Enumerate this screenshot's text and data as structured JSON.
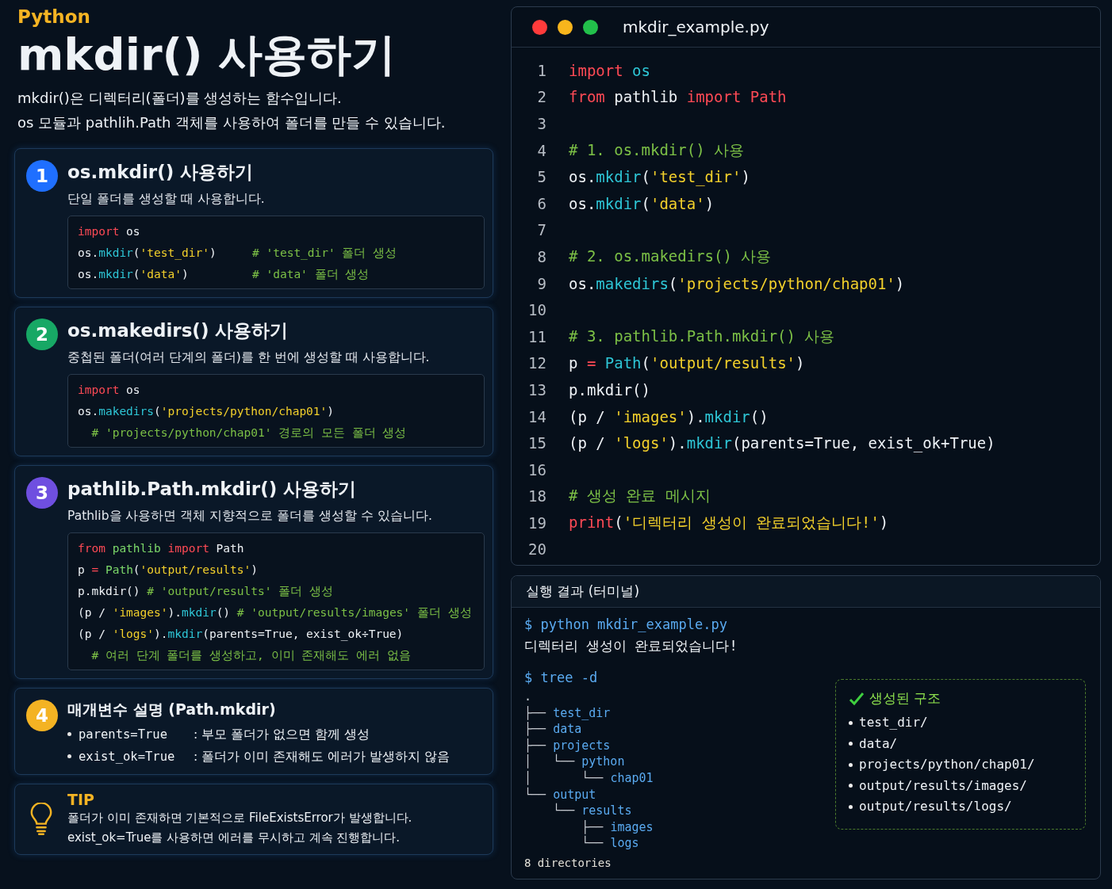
{
  "header": {
    "eyebrow": "Python",
    "title": "mkdir() 사용하기",
    "description": [
      "mkdir()은 디렉터리(폴더)를 생성하는 함수입니다.",
      "os 모듈과 pathlih.Path 객체를 사용하여 폴더를 만들 수 있습니다."
    ]
  },
  "cards": [
    {
      "kind": "code",
      "number": "1",
      "color": "#1f6fff",
      "title": "os.mkdir() 사용하기",
      "description": "단일 폴더를 생성할 때 사용합니다.",
      "code": [
        {
          "tokens": [
            {
              "t": "import",
              "kind": "kw"
            },
            {
              "t": " os",
              "kind": "tx"
            }
          ]
        },
        {
          "tokens": [
            {
              "t": "os.",
              "kind": "tx"
            },
            {
              "t": "mkdir",
              "kind": "fn"
            },
            {
              "t": "(",
              "kind": "tx"
            },
            {
              "t": "'test_dir'",
              "kind": "str"
            },
            {
              "t": ")",
              "kind": "tx"
            }
          ],
          "comment": "# 'test_dir' 폴더 생성"
        },
        {
          "tokens": [
            {
              "t": "os.",
              "kind": "tx"
            },
            {
              "t": "mkdir",
              "kind": "fn"
            },
            {
              "t": "(",
              "kind": "tx"
            },
            {
              "t": "'data'",
              "kind": "str"
            },
            {
              "t": ")",
              "kind": "tx"
            }
          ],
          "comment": "# 'data' 폴더 생성"
        }
      ]
    },
    {
      "kind": "code",
      "number": "2",
      "color": "#17a865",
      "title": "os.makedirs() 사용하기",
      "description": "중첩된 폴더(여러 단계의 폴더)를 한 번에 생성할 때 사용합니다.",
      "code": [
        {
          "tokens": [
            {
              "t": "import",
              "kind": "kw"
            },
            {
              "t": " os",
              "kind": "tx"
            }
          ]
        },
        {
          "tokens": [
            {
              "t": "os.",
              "kind": "tx"
            },
            {
              "t": "makedirs",
              "kind": "fn"
            },
            {
              "t": "(",
              "kind": "tx"
            },
            {
              "t": "'projects/python/chap01'",
              "kind": "str"
            },
            {
              "t": ")",
              "kind": "tx"
            }
          ]
        },
        {
          "tokens": [
            {
              "t": "  # 'projects/python/chap01' 경로의 모든 폴더 생성",
              "kind": "cm"
            }
          ]
        }
      ]
    },
    {
      "kind": "code",
      "number": "3",
      "color": "#6f4fe0",
      "title": "pathlib.Path.mkdir() 사용하기",
      "description": "Pathlib을 사용하면 객체 지향적으로 폴더를 생성할 수 있습니다.",
      "code": [
        {
          "tokens": [
            {
              "t": "from ",
              "kind": "kw"
            },
            {
              "t": "pathlib ",
              "kind": "mod"
            },
            {
              "t": "import",
              "kind": "kw"
            },
            {
              "t": " Path",
              "kind": "tx"
            }
          ]
        },
        {
          "tokens": [
            {
              "t": "p ",
              "kind": "tx"
            },
            {
              "t": "= ",
              "kind": "kw"
            },
            {
              "t": "Path",
              "kind": "mod"
            },
            {
              "t": "(",
              "kind": "tx"
            },
            {
              "t": "'output/results'",
              "kind": "str"
            },
            {
              "t": ")",
              "kind": "tx"
            }
          ]
        },
        {
          "tokens": [
            {
              "t": "p.mkdir() ",
              "kind": "tx"
            },
            {
              "t": "# 'output/results' 폴더 생성",
              "kind": "cm"
            }
          ]
        },
        {
          "tokens": [
            {
              "t": "(p / ",
              "kind": "tx"
            },
            {
              "t": "'images'",
              "kind": "str"
            },
            {
              "t": ").",
              "kind": "tx"
            },
            {
              "t": "mkdir",
              "kind": "fn"
            },
            {
              "t": "() ",
              "kind": "tx"
            },
            {
              "t": "# 'output/results/images' 폴더 생성",
              "kind": "cm"
            }
          ]
        },
        {
          "tokens": [
            {
              "t": "(p / ",
              "kind": "tx"
            },
            {
              "t": "'logs'",
              "kind": "str"
            },
            {
              "t": ").",
              "kind": "tx"
            },
            {
              "t": "mkdir",
              "kind": "fn"
            },
            {
              "t": "(parents=True, exist_ok÷True)",
              "kind": "tx"
            }
          ]
        },
        {
          "tokens": [
            {
              "t": "  # 여러 단계 폴더를 생성하고, 이미 존재해도 에러 없음",
              "kind": "cm"
            }
          ]
        }
      ]
    },
    {
      "kind": "params",
      "number": "4",
      "color": "#f4b323",
      "title": "매개변수 설명 (Path.mkdir)",
      "params": [
        {
          "name": "parents=True",
          "text": ": 부모 폴더가 없으면 함께 생성"
        },
        {
          "name": "exist_ok=True",
          "text": ": 폴더가 이미 존재해도 에러가 발생하지 않음"
        }
      ]
    },
    {
      "kind": "tip",
      "title": "TIP",
      "lines": [
        "폴더가 이미 존재하면 기본적으로 FileExistsError가 발생합니다.",
        "exist_ok=True를 사용하면 에러를 무시하고 계속 진행합니다."
      ]
    }
  ],
  "editor": {
    "filename": "mkdir_example.py",
    "lines": [
      {
        "n": "1",
        "tokens": [
          {
            "t": "import ",
            "kind": "kw"
          },
          {
            "t": "os",
            "kind": "fn"
          }
        ]
      },
      {
        "n": "2",
        "tokens": [
          {
            "t": "from",
            "kind": "kw"
          },
          {
            "t": " pathlib ",
            "kind": "tx"
          },
          {
            "t": "import Path",
            "kind": "kw"
          }
        ]
      },
      {
        "n": "3"
      },
      {
        "n": "4",
        "tokens": [
          {
            "t": "# 1. os.mkdir() 사용",
            "kind": "cm"
          }
        ]
      },
      {
        "n": "5",
        "tokens": [
          {
            "t": "os.",
            "kind": "tx"
          },
          {
            "t": "mkdir",
            "kind": "fn"
          },
          {
            "t": "(",
            "kind": "tx"
          },
          {
            "t": "'test_dir'",
            "kind": "str"
          },
          {
            "t": ")",
            "kind": "tx"
          }
        ]
      },
      {
        "n": "6",
        "tokens": [
          {
            "t": "os.",
            "kind": "tx"
          },
          {
            "t": "mkdir",
            "kind": "fn"
          },
          {
            "t": "(",
            "kind": "tx"
          },
          {
            "t": "'data'",
            "kind": "str"
          },
          {
            "t": ")",
            "kind": "tx"
          }
        ]
      },
      {
        "n": "7"
      },
      {
        "n": "8",
        "tokens": [
          {
            "t": "# 2. os.makedirs() 사용",
            "kind": "cm"
          }
        ]
      },
      {
        "n": "9",
        "tokens": [
          {
            "t": "os.",
            "kind": "tx"
          },
          {
            "t": "makedirs",
            "kind": "fn"
          },
          {
            "t": "(",
            "kind": "tx"
          },
          {
            "t": "'projects/python/chap01'",
            "kind": "str"
          },
          {
            "t": ")",
            "kind": "tx"
          }
        ]
      },
      {
        "n": "10"
      },
      {
        "n": "11",
        "tokens": [
          {
            "t": "# 3. pathlib.Path.mkdir() 사용",
            "kind": "cm"
          }
        ]
      },
      {
        "n": "12",
        "tokens": [
          {
            "t": "p ",
            "kind": "tx"
          },
          {
            "t": "= ",
            "kind": "kw"
          },
          {
            "t": "Path",
            "kind": "fn"
          },
          {
            "t": "(",
            "kind": "tx"
          },
          {
            "t": "'output/results'",
            "kind": "str"
          },
          {
            "t": ")",
            "kind": "tx"
          }
        ]
      },
      {
        "n": "13",
        "tokens": [
          {
            "t": "p.mkdir()",
            "kind": "tx"
          }
        ]
      },
      {
        "n": "14",
        "tokens": [
          {
            "t": "(p / ",
            "kind": "tx"
          },
          {
            "t": "'images'",
            "kind": "str"
          },
          {
            "t": ").",
            "kind": "tx"
          },
          {
            "t": "mkdir",
            "kind": "fn"
          },
          {
            "t": "()",
            "kind": "tx"
          }
        ]
      },
      {
        "n": "15",
        "tokens": [
          {
            "t": "(p / ",
            "kind": "tx"
          },
          {
            "t": "'logs'",
            "kind": "str"
          },
          {
            "t": ").",
            "kind": "tx"
          },
          {
            "t": "mkdir",
            "kind": "fn"
          },
          {
            "t": "(parents=True, exist_ok+True)",
            "kind": "tx"
          }
        ]
      },
      {
        "n": "16"
      },
      {
        "n": "18",
        "tokens": [
          {
            "t": "# 생성 완료 메시지",
            "kind": "cm"
          }
        ]
      },
      {
        "n": "19",
        "tokens": [
          {
            "t": "print",
            "kind": "kw"
          },
          {
            "t": "(",
            "kind": "tx"
          },
          {
            "t": "'디렉터리 생성이 완료되었습니다!'",
            "kind": "str"
          },
          {
            "t": ")",
            "kind": "tx"
          }
        ]
      },
      {
        "n": "20"
      }
    ]
  },
  "terminal": {
    "title": "실행 결과 (터미널)",
    "lines": [
      {
        "kind": "cmd",
        "text": "$ python mkdir_example.py"
      },
      {
        "kind": "out",
        "text": "디렉터리 생성이 완료되었습니다!"
      },
      {
        "kind": "gap"
      },
      {
        "kind": "cmd",
        "text": "$ tree -d"
      },
      {
        "kind": "tree",
        "prefix": "."
      },
      {
        "kind": "tree",
        "prefix": "├── ",
        "name": "test_dir"
      },
      {
        "kind": "tree",
        "prefix": "├── ",
        "name": "data"
      },
      {
        "kind": "tree",
        "prefix": "├── ",
        "name": "projects"
      },
      {
        "kind": "tree",
        "prefix": "│   └── ",
        "name": "python"
      },
      {
        "kind": "tree",
        "prefix": "│       └── ",
        "name": "chap01"
      },
      {
        "kind": "tree",
        "prefix": "└── ",
        "name": "output"
      },
      {
        "kind": "tree",
        "prefix": "    └── ",
        "name": "results"
      },
      {
        "kind": "tree",
        "prefix": "        ├── ",
        "name": "images"
      },
      {
        "kind": "tree",
        "prefix": "        └── ",
        "name": "logs"
      },
      {
        "kind": "small",
        "text": "8 directories"
      }
    ],
    "summary": {
      "title": "생성된 구조",
      "items": [
        "test_dir/",
        "data/",
        "projects/python/chap01/",
        "output/results/images/",
        "output/results/logs/"
      ]
    }
  }
}
